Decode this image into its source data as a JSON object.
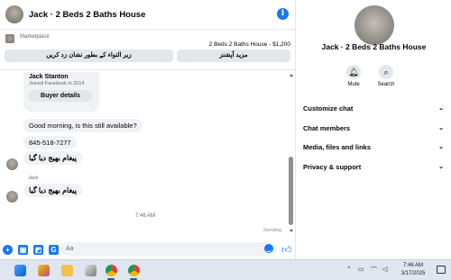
{
  "chat": {
    "title": "Jack · 2 Beds 2 Baths House",
    "info_icon": "i",
    "marketplace_label": "Marketplace",
    "listing": "2 Beds 2 Baths House - $1,200",
    "btn_urdu_mark_pending": "زیر التواء کے بطور نشان زد کریں",
    "btn_urdu_more_options": "مزید آپشنز"
  },
  "buyer_card": {
    "name": "Jack Stanton",
    "joined": "Joined Facebook in 2014",
    "button": "Buyer details"
  },
  "messages": {
    "m1": "Good morning, is this still available?",
    "m2": "845-518-7277",
    "m3": "پیغام بھیج دیا گیا",
    "sender": "Jack",
    "m4": "پیغام بھیج دیا گیا",
    "time": "7:46 AM",
    "status": "Sending"
  },
  "composer": {
    "placeholder": "Aa"
  },
  "info": {
    "title": "Jack · 2 Beds 2 Baths House",
    "mute_label": "Mute",
    "search_label": "Search",
    "sections": [
      "Customize chat",
      "Chat members",
      "Media, files and links",
      "Privacy & support"
    ]
  },
  "taskbar": {
    "time": "7:46 AM",
    "date": "3/17/2025"
  },
  "colors": {
    "accent": "#1877f2",
    "bubble": "#f0f2f5",
    "taskbar": "#dfe6ef"
  }
}
